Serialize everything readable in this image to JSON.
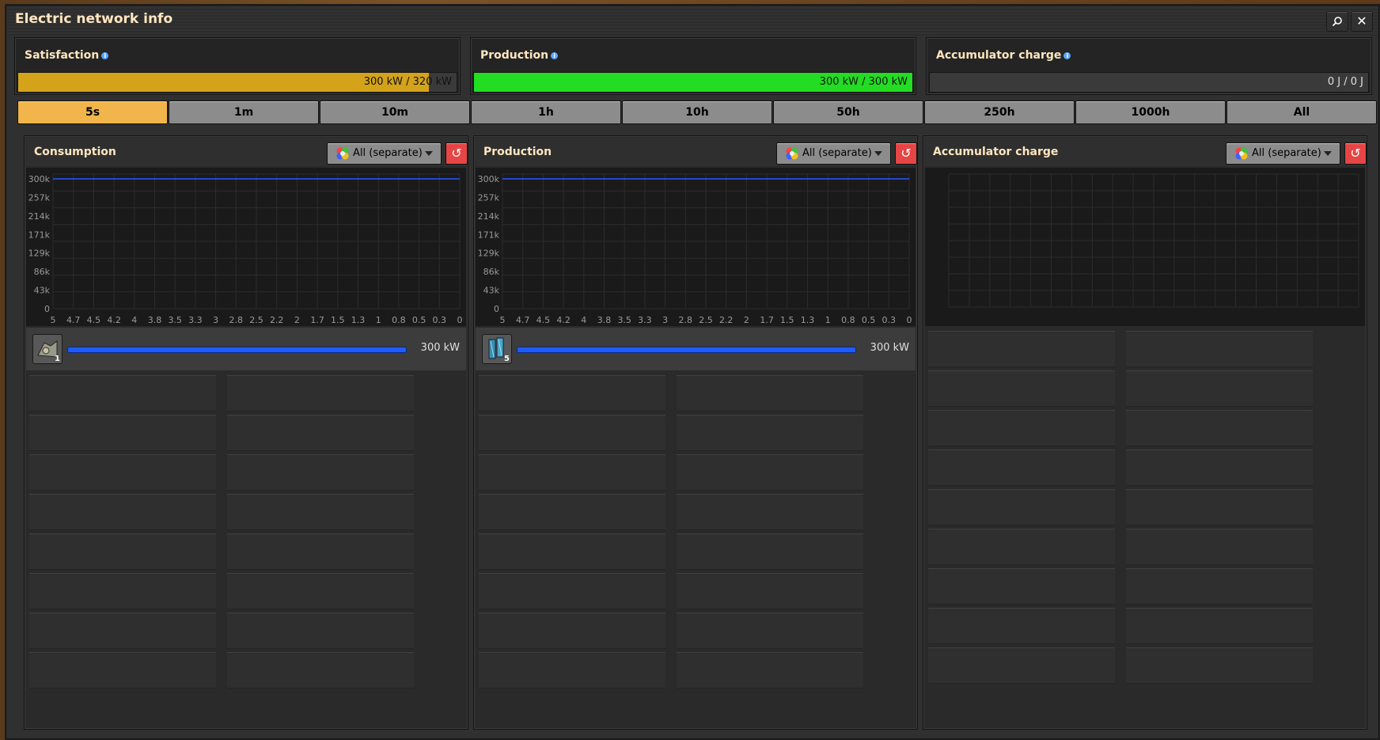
{
  "window": {
    "title": "Electric network info"
  },
  "titlebar": {
    "search_icon": "search-icon",
    "close_icon": "close-icon"
  },
  "stats": {
    "satisfaction": {
      "label": "Satisfaction",
      "value_text": "300 kW / 320 kW",
      "fill": 0.9375,
      "color": "#d4a319"
    },
    "production": {
      "label": "Production",
      "value_text": "300 kW / 300 kW",
      "fill": 1.0,
      "color": "#22dd22"
    },
    "accumulator": {
      "label": "Accumulator charge",
      "value_text": "0 J / 0 J",
      "fill": 0.0
    }
  },
  "time_tabs": [
    "5s",
    "1m",
    "10m",
    "1h",
    "10h",
    "50h",
    "250h",
    "1000h",
    "All"
  ],
  "active_tab": "5s",
  "panels": {
    "consumption": {
      "title": "Consumption",
      "dropdown": "All (separate)",
      "legend": {
        "icon": "lab-icon",
        "count": "1",
        "value": "300 kW",
        "fill": 1.0
      }
    },
    "production": {
      "title": "Production",
      "dropdown": "All (separate)",
      "legend": {
        "icon": "solar-panel-icon",
        "count": "5",
        "value": "300 kW",
        "fill": 1.0
      }
    },
    "accumulator": {
      "title": "Accumulator charge",
      "dropdown": "All (separate)"
    }
  },
  "chart_data": [
    {
      "type": "line",
      "title": "Consumption",
      "y_ticks": [
        "300k",
        "257k",
        "214k",
        "171k",
        "129k",
        "86k",
        "43k",
        "0"
      ],
      "x_ticks": [
        "5",
        "4.7",
        "4.5",
        "4.2",
        "4",
        "3.8",
        "3.5",
        "3.3",
        "3",
        "2.8",
        "2.5",
        "2.2",
        "2",
        "1.7",
        "1.5",
        "1.3",
        "1",
        "0.8",
        "0.5",
        "0.3",
        "0"
      ],
      "ylim": [
        0,
        300
      ],
      "xlim": [
        5,
        0
      ],
      "series": [
        {
          "x": [
            5,
            0
          ],
          "y": [
            300,
            300
          ],
          "color": "#2b55ff"
        }
      ],
      "grid": true
    },
    {
      "type": "line",
      "title": "Production",
      "y_ticks": [
        "300k",
        "257k",
        "214k",
        "171k",
        "129k",
        "86k",
        "43k",
        "0"
      ],
      "x_ticks": [
        "5",
        "4.7",
        "4.5",
        "4.2",
        "4",
        "3.8",
        "3.5",
        "3.3",
        "3",
        "2.8",
        "2.5",
        "2.2",
        "2",
        "1.7",
        "1.5",
        "1.3",
        "1",
        "0.8",
        "0.5",
        "0.3",
        "0"
      ],
      "ylim": [
        0,
        300
      ],
      "xlim": [
        5,
        0
      ],
      "series": [
        {
          "x": [
            5,
            0
          ],
          "y": [
            300,
            300
          ],
          "color": "#2b55ff"
        }
      ],
      "grid": true
    },
    {
      "type": "line",
      "title": "Accumulator charge",
      "y_ticks": [],
      "x_ticks": [],
      "series": [],
      "grid": true
    }
  ]
}
